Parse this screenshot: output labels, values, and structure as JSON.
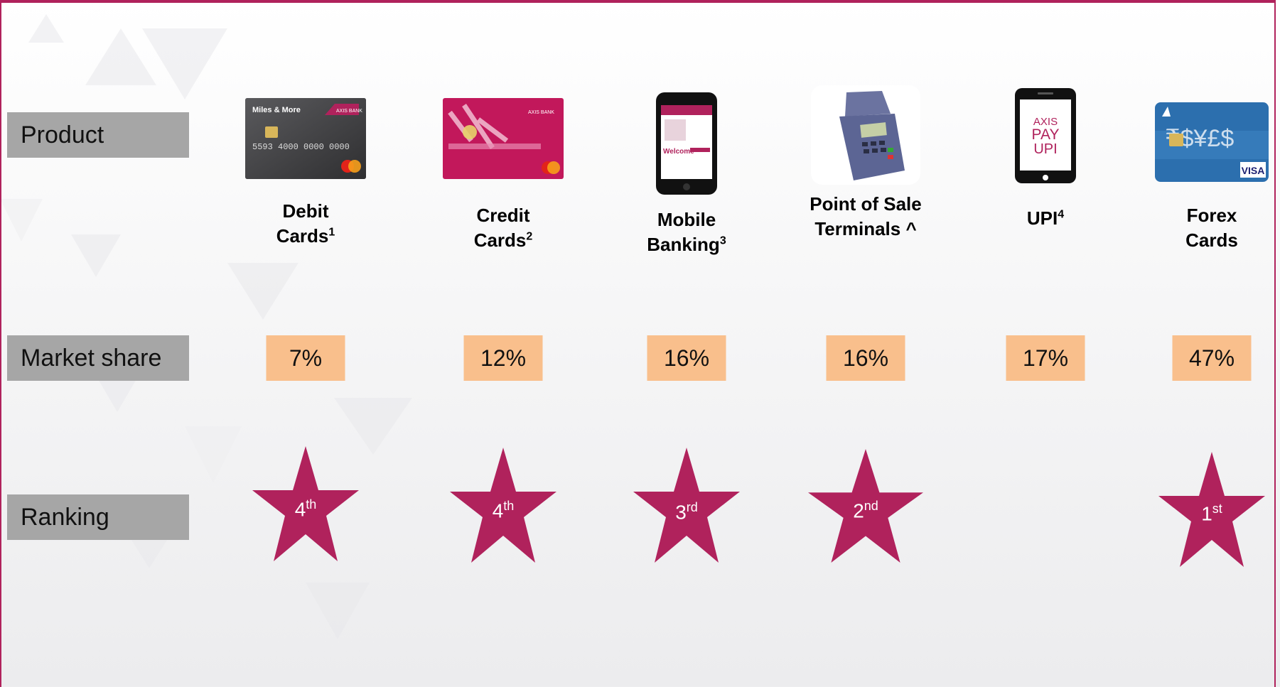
{
  "row_labels": {
    "product": "Product",
    "market_share": "Market share",
    "ranking": "Ranking"
  },
  "products": [
    {
      "name_line1": "Debit",
      "name_line2": "Cards",
      "sup": "1",
      "share": "7%",
      "rank": "4",
      "rank_suffix": "th",
      "icon": "debit-card-icon"
    },
    {
      "name_line1": "Credit",
      "name_line2": "Cards",
      "sup": "2",
      "share": "12%",
      "rank": "4",
      "rank_suffix": "th",
      "icon": "credit-card-icon"
    },
    {
      "name_line1": "Mobile",
      "name_line2": "Banking",
      "sup": "3",
      "share": "16%",
      "rank": "3",
      "rank_suffix": "rd",
      "icon": "mobile-phone-icon"
    },
    {
      "name_line1": "Point of Sale",
      "name_line2": "Terminals ^",
      "sup": "",
      "share": "16%",
      "rank": "2",
      "rank_suffix": "nd",
      "icon": "pos-terminal-icon"
    },
    {
      "name_line1": "UPI",
      "name_line2": "",
      "sup": "4",
      "share": "17%",
      "rank": "",
      "rank_suffix": "",
      "icon": "upi-phone-icon"
    },
    {
      "name_line1": "Forex",
      "name_line2": "Cards",
      "sup": "",
      "share": "47%",
      "rank": "1",
      "rank_suffix": "st",
      "icon": "forex-card-icon"
    }
  ],
  "image_text": {
    "debit_card": "5593 4000 0000 0000",
    "debit_brand": "Miles & More",
    "bank": "AXIS BANK",
    "phone_welcome": "Welcome",
    "upi_logo": [
      "AXIS",
      "PAY",
      "UPI"
    ],
    "forex_visa": "VISA"
  },
  "colors": {
    "accent": "#b0225c",
    "label_bg": "#a6a6a6",
    "share_bg": "#f9bf8c"
  }
}
